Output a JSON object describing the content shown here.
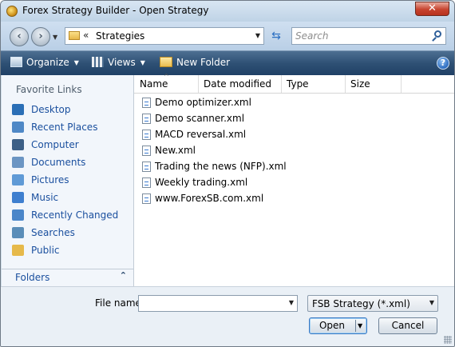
{
  "window": {
    "title": "Forex Strategy Builder - Open Strategy",
    "close_glyph": "✕"
  },
  "address_bar": {
    "separator": "«",
    "path": "Strategies",
    "search_placeholder": "Search"
  },
  "toolbar": {
    "organize_label": "Organize",
    "views_label": "Views",
    "new_folder_label": "New Folder",
    "help_glyph": "?"
  },
  "sidebar": {
    "heading": "Favorite Links",
    "items": [
      {
        "label": "Desktop",
        "icon": "desktop-icon",
        "color": "#2b6fb6"
      },
      {
        "label": "Recent Places",
        "icon": "recent-places-icon",
        "color": "#4f88c6"
      },
      {
        "label": "Computer",
        "icon": "computer-icon",
        "color": "#3c5f86"
      },
      {
        "label": "Documents",
        "icon": "documents-icon",
        "color": "#6b95c3"
      },
      {
        "label": "Pictures",
        "icon": "pictures-icon",
        "color": "#5f9ad6"
      },
      {
        "label": "Music",
        "icon": "music-icon",
        "color": "#3e7fcf"
      },
      {
        "label": "Recently Changed",
        "icon": "recently-changed-icon",
        "color": "#4a86c9"
      },
      {
        "label": "Searches",
        "icon": "searches-icon",
        "color": "#5a8db8"
      },
      {
        "label": "Public",
        "icon": "public-folder-icon",
        "color": "#e6b94a"
      }
    ],
    "folders_label": "Folders",
    "folders_chevron": "⌃"
  },
  "file_list": {
    "columns": [
      "Name",
      "Date modified",
      "Type",
      "Size"
    ],
    "sort_glyph": "^",
    "files": [
      "Demo optimizer.xml",
      "Demo scanner.xml",
      "MACD reversal.xml",
      "New.xml",
      "Trading the news (NFP).xml",
      "Weekly trading.xml",
      "www.ForexSB.com.xml"
    ]
  },
  "footer": {
    "file_name_label": "File name:",
    "file_name_value": "",
    "file_type_value": "FSB Strategy (*.xml)",
    "open_label": "Open",
    "cancel_label": "Cancel"
  }
}
